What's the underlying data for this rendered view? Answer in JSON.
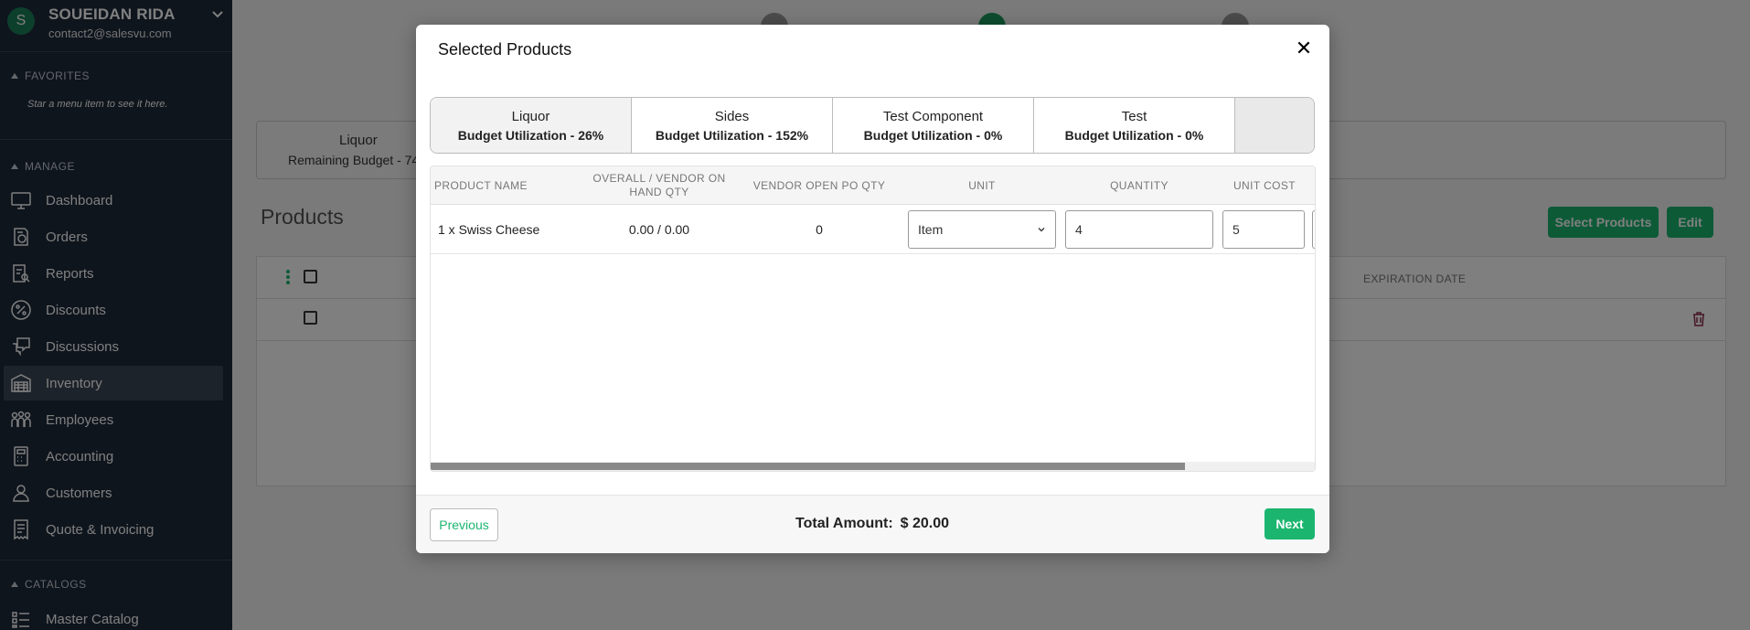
{
  "user": {
    "initial": "S",
    "name": "SOUEIDAN RIDA",
    "email": "contact2@salesvu.com"
  },
  "sidebar": {
    "favorites_header": "FAVORITES",
    "favorites_note": "Star a menu item to see it here.",
    "manage_header": "MANAGE",
    "items": [
      {
        "label": "Dashboard",
        "icon": "dashboard-icon"
      },
      {
        "label": "Orders",
        "icon": "orders-icon"
      },
      {
        "label": "Reports",
        "icon": "reports-icon"
      },
      {
        "label": "Discounts",
        "icon": "discounts-icon"
      },
      {
        "label": "Discussions",
        "icon": "discussions-icon"
      },
      {
        "label": "Inventory",
        "icon": "inventory-icon",
        "active": true
      },
      {
        "label": "Employees",
        "icon": "employees-icon"
      },
      {
        "label": "Accounting",
        "icon": "accounting-icon"
      },
      {
        "label": "Customers",
        "icon": "customers-icon"
      },
      {
        "label": "Quote & Invoicing",
        "icon": "invoicing-icon"
      }
    ],
    "catalogs_header": "CATALOGS",
    "catalog_items": [
      {
        "label": "Master Catalog",
        "icon": "catalog-icon"
      }
    ]
  },
  "background": {
    "budget_label": "Liquor",
    "budget_remaining": "Remaining Budget - 74",
    "products_title": "Products",
    "select_products_label": "Select Products",
    "edit_label": "Edit",
    "expiration_header": "EXPIRATION DATE"
  },
  "modal": {
    "title": "Selected Products",
    "close_glyph": "✕",
    "budgets": [
      {
        "name": "Liquor",
        "utilization": "Budget Utilization - 26%"
      },
      {
        "name": "Sides",
        "utilization": "Budget Utilization - 152%"
      },
      {
        "name": "Test Component",
        "utilization": "Budget Utilization - 0%"
      },
      {
        "name": "Test",
        "utilization": "Budget Utilization - 0%"
      }
    ],
    "table": {
      "headers": {
        "product_name": "PRODUCT NAME",
        "on_hand": "OVERALL / VENDOR ON HAND QTY",
        "open_po": "VENDOR OPEN PO QTY",
        "unit": "UNIT",
        "quantity": "QUANTITY",
        "unit_cost": "UNIT COST"
      },
      "rows": [
        {
          "product_name": "1 x Swiss Cheese",
          "on_hand": "0.00 / 0.00",
          "open_po": "0",
          "unit": "Item",
          "quantity": "4",
          "unit_cost": "5"
        }
      ]
    },
    "footer": {
      "previous_label": "Previous",
      "total_label": "Total Amount:",
      "total_value": "$ 20.00",
      "next_label": "Next"
    }
  },
  "colors": {
    "accent": "#1bb56f",
    "sidebar": "#1e2a3a"
  }
}
